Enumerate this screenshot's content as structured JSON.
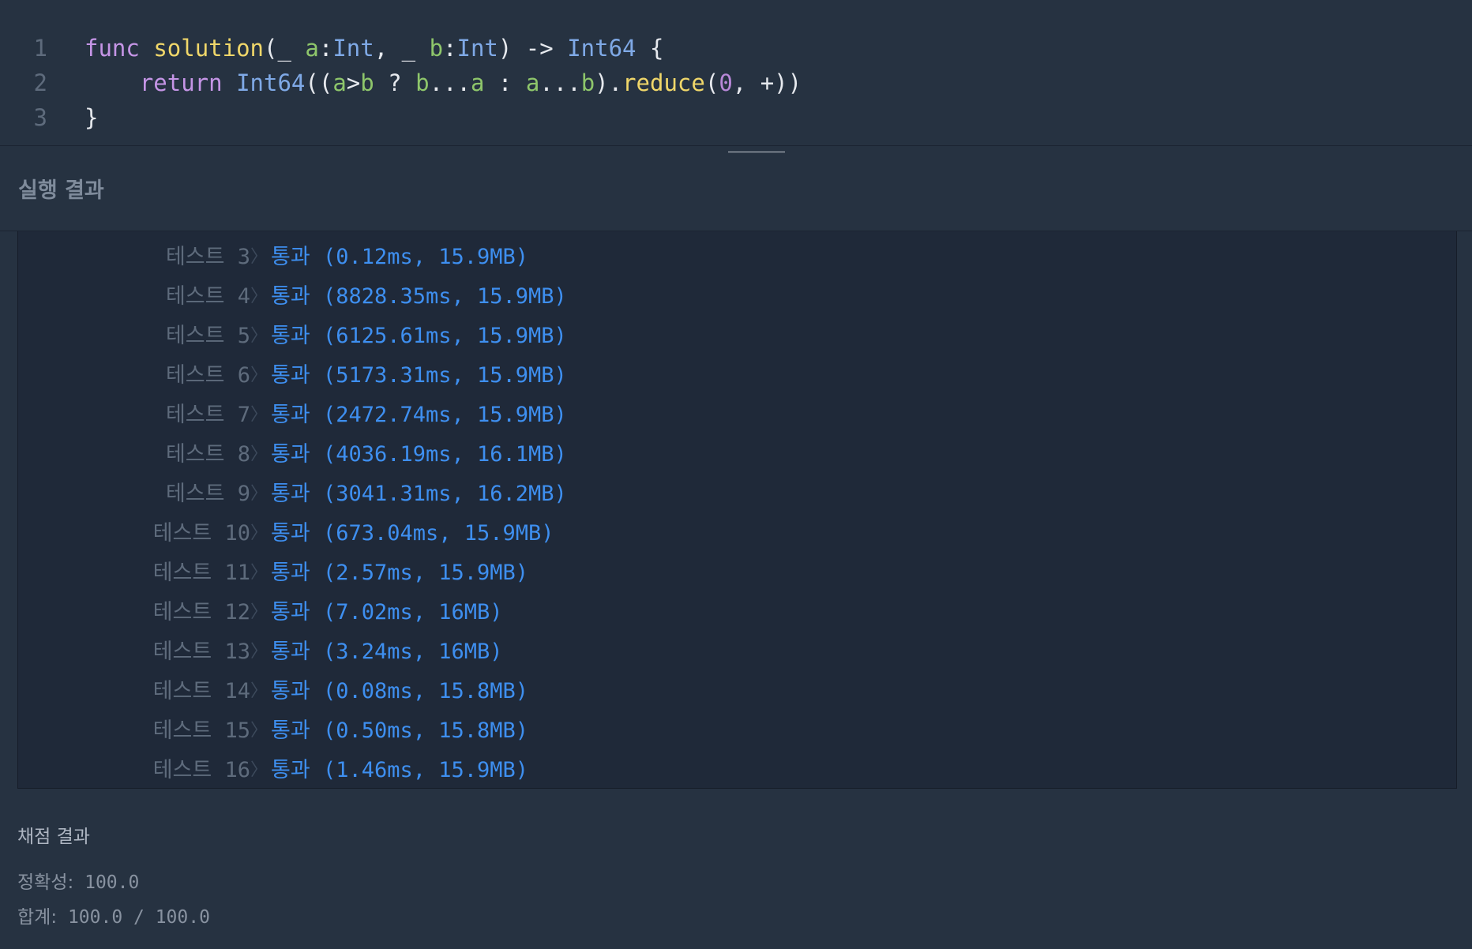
{
  "editor": {
    "lines": [
      {
        "num": "1"
      },
      {
        "num": "2"
      },
      {
        "num": "3"
      }
    ],
    "tokens": {
      "l1_kw": "func",
      "l1_fn": "solution",
      "l1_p1": "(_ ",
      "l1_a": "a",
      "l1_c1": ":",
      "l1_t1": "Int",
      "l1_p2": ", _ ",
      "l1_b": "b",
      "l1_c2": ":",
      "l1_t2": "Int",
      "l1_p3": ") -> ",
      "l1_t3": "Int64",
      "l1_p4": " {",
      "l2_kw": "return",
      "l2_t": "Int64",
      "l2_p1": "((",
      "l2_a": "a",
      "l2_p2": ">",
      "l2_b": "b",
      "l2_p3": " ? ",
      "l2_b2": "b",
      "l2_p4": "...",
      "l2_a2": "a",
      "l2_p5": " : ",
      "l2_a3": "a",
      "l2_p6": "...",
      "l2_b3": "b",
      "l2_p7": ").",
      "l2_fn": "reduce",
      "l2_p8": "(",
      "l2_n": "0",
      "l2_p9": ", +))",
      "l3_p": "}"
    }
  },
  "result": {
    "title": "실행 결과",
    "tests": [
      {
        "label": "테스트",
        "num": "3",
        "status": "통과",
        "detail": "(0.12ms, 15.9MB)"
      },
      {
        "label": "테스트",
        "num": "4",
        "status": "통과",
        "detail": "(8828.35ms, 15.9MB)"
      },
      {
        "label": "테스트",
        "num": "5",
        "status": "통과",
        "detail": "(6125.61ms, 15.9MB)"
      },
      {
        "label": "테스트",
        "num": "6",
        "status": "통과",
        "detail": "(5173.31ms, 15.9MB)"
      },
      {
        "label": "테스트",
        "num": "7",
        "status": "통과",
        "detail": "(2472.74ms, 15.9MB)"
      },
      {
        "label": "테스트",
        "num": "8",
        "status": "통과",
        "detail": "(4036.19ms, 16.1MB)"
      },
      {
        "label": "테스트",
        "num": "9",
        "status": "통과",
        "detail": "(3041.31ms, 16.2MB)"
      },
      {
        "label": "테스트",
        "num": "10",
        "status": "통과",
        "detail": "(673.04ms, 15.9MB)"
      },
      {
        "label": "테스트",
        "num": "11",
        "status": "통과",
        "detail": "(2.57ms, 15.9MB)"
      },
      {
        "label": "테스트",
        "num": "12",
        "status": "통과",
        "detail": "(7.02ms, 16MB)"
      },
      {
        "label": "테스트",
        "num": "13",
        "status": "통과",
        "detail": "(3.24ms, 16MB)"
      },
      {
        "label": "테스트",
        "num": "14",
        "status": "통과",
        "detail": "(0.08ms, 15.8MB)"
      },
      {
        "label": "테스트",
        "num": "15",
        "status": "통과",
        "detail": "(0.50ms, 15.8MB)"
      },
      {
        "label": "테스트",
        "num": "16",
        "status": "통과",
        "detail": "(1.46ms, 15.9MB)"
      }
    ]
  },
  "grading": {
    "title": "채점 결과",
    "accuracy_label": "정확성:",
    "accuracy_value": "100.0",
    "total_label": "합계:",
    "total_value": "100.0 / 100.0"
  },
  "colors": {
    "background": "#263241",
    "panel": "#1f2939",
    "pass": "#3e8ff0",
    "keyword": "#c595e6",
    "function": "#f0d76a",
    "type": "#7fa9e6",
    "param": "#8ec66b"
  }
}
